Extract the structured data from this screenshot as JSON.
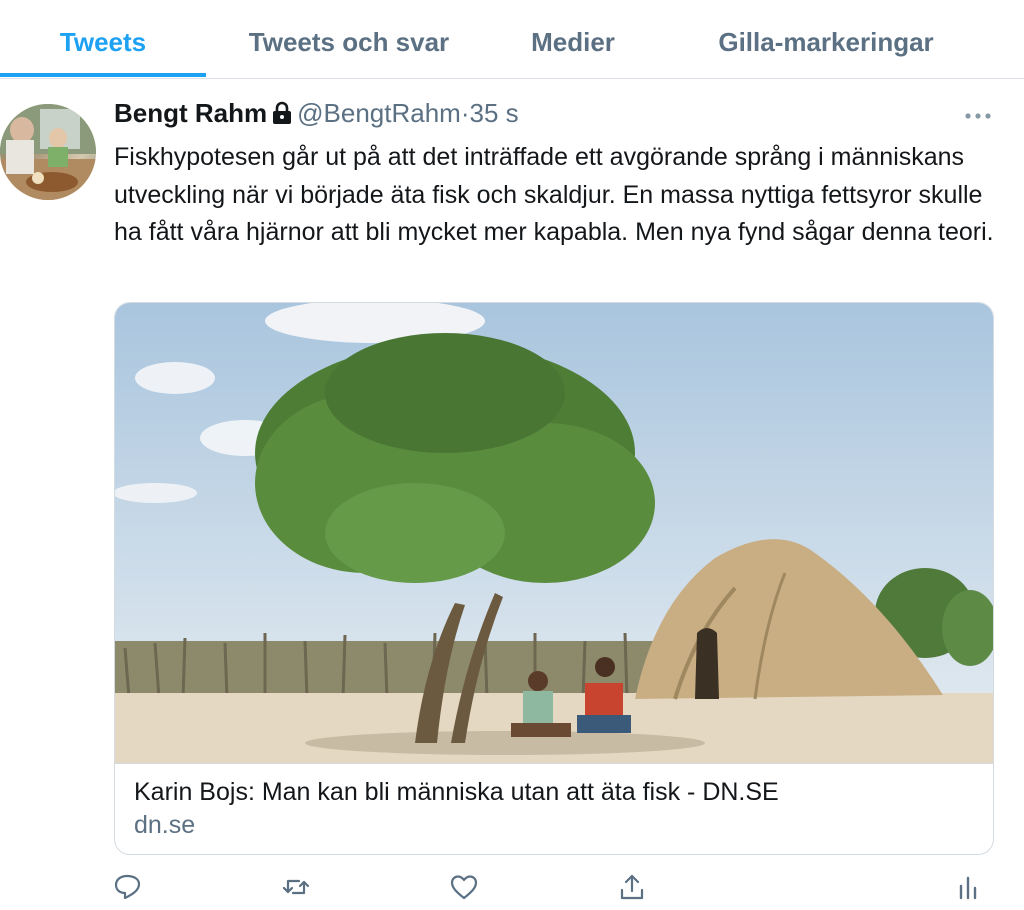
{
  "tabs": [
    {
      "label": "Tweets",
      "active": true
    },
    {
      "label": "Tweets och svar",
      "active": false
    },
    {
      "label": "Medier",
      "active": false
    },
    {
      "label": "Gilla-markeringar",
      "active": false
    }
  ],
  "tweet": {
    "author_name": "Bengt Rahm",
    "handle": "@BengtRahm",
    "separator": "·",
    "time": "35 s",
    "text": "Fiskhypotesen går ut på att det inträffade ett avgörande språng i människans utveckling när vi började äta fisk och skaldjur. En massa nyttiga fettsyror skulle ha fått våra hjärnor att bli mycket mer kapabla. Men nya fynd sågar denna teori."
  },
  "card": {
    "title": "Karin Bojs: Man kan bli människa utan att äta fisk - DN.SE",
    "domain": "dn.se"
  },
  "actions": [
    "reply-icon",
    "retweet-icon",
    "like-icon",
    "share-icon",
    "analytics-icon"
  ],
  "colors": {
    "accent": "#1da1f2",
    "secondary_text": "#5b7083",
    "primary_text": "#14171a",
    "border": "#d3dbe1"
  }
}
